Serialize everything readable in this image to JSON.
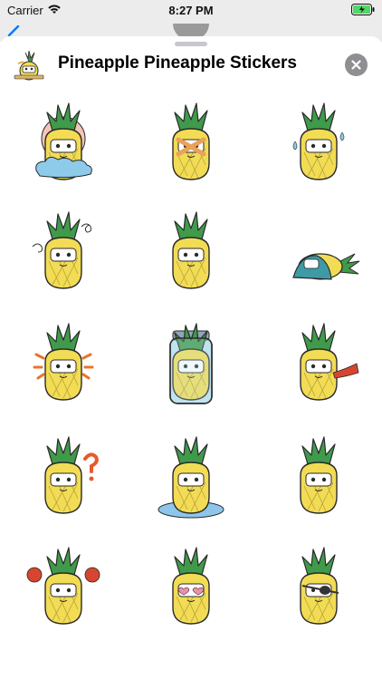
{
  "status_bar": {
    "carrier": "Carrier",
    "time": "8:27 PM"
  },
  "header": {
    "title": "Pineapple Pineapple Stickers",
    "icon": "pineapple-app-icon",
    "close_icon": "close-icon"
  },
  "colors": {
    "pineapple_body": "#f2dc55",
    "crown": "#3f9b4a",
    "outline": "#2a2a2a",
    "close_bg": "#8e8e93"
  },
  "stickers": [
    {
      "name": "pineapple-sun-cloud",
      "extra": "sun-cloud"
    },
    {
      "name": "pineapple-taped-mouth",
      "extra": "tape"
    },
    {
      "name": "pineapple-crying",
      "extra": "tears"
    },
    {
      "name": "pineapple-dizzy",
      "extra": "dizzy"
    },
    {
      "name": "pineapple-shocked",
      "extra": "none"
    },
    {
      "name": "pineapple-lying-blanket",
      "extra": "blanket"
    },
    {
      "name": "pineapple-surprised-pacifier",
      "extra": "burst"
    },
    {
      "name": "pineapple-in-jar",
      "extra": "jar"
    },
    {
      "name": "pineapple-spitting",
      "extra": "spit"
    },
    {
      "name": "pineapple-confused",
      "extra": "question"
    },
    {
      "name": "pineapple-sobbing-puddle",
      "extra": "puddle"
    },
    {
      "name": "pineapple-smiling",
      "extra": "none"
    },
    {
      "name": "pineapple-angry",
      "extra": "angry"
    },
    {
      "name": "pineapple-heart-eyes",
      "extra": "hearts"
    },
    {
      "name": "pineapple-eyepatch",
      "extra": "eyepatch"
    }
  ]
}
